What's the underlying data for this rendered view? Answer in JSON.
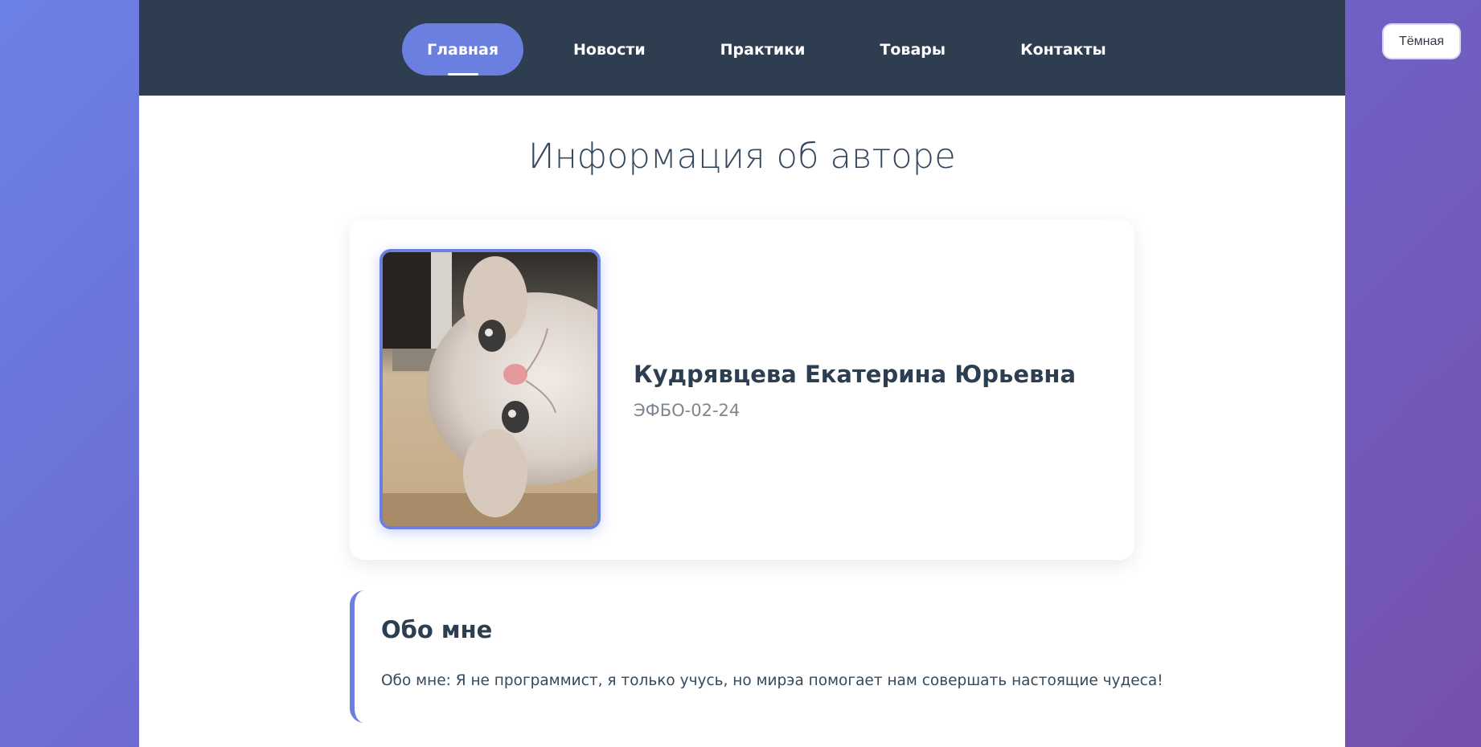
{
  "nav": {
    "items": [
      {
        "label": "Главная",
        "active": true
      },
      {
        "label": "Новости",
        "active": false
      },
      {
        "label": "Практики",
        "active": false
      },
      {
        "label": "Товары",
        "active": false
      },
      {
        "label": "Контакты",
        "active": false
      }
    ]
  },
  "theme_toggle": {
    "label": "Тёмная"
  },
  "main": {
    "title": "Информация об авторе",
    "profile": {
      "photo_icon": "kitten-photo",
      "name": "Кудрявцева Екатерина Юрьевна",
      "group": "ЭФБО-02-24"
    },
    "about": {
      "heading": "Обо мне",
      "text": "Обо мне: Я не программист, я только учусь, но мирэа помогает нам совершать настоящие чудеса!"
    }
  },
  "colors": {
    "navbar": "#2e3d50",
    "accent": "#6a7fe0",
    "background_start": "#6b80e6",
    "background_end": "#7651ad"
  }
}
